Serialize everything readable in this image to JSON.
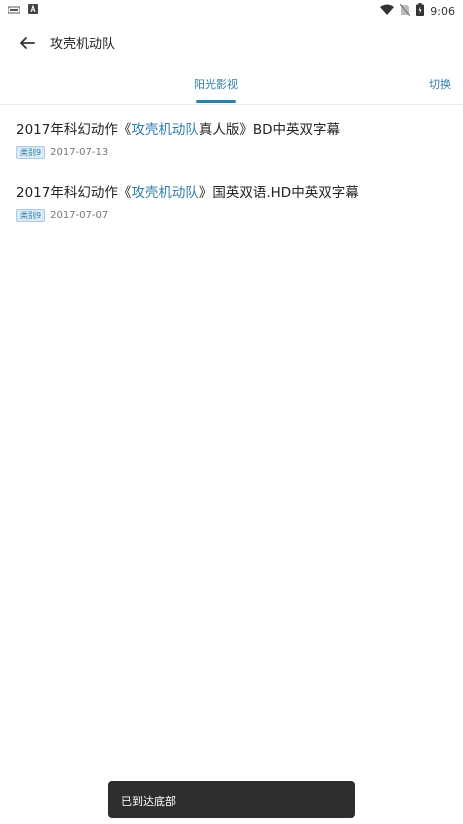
{
  "status_bar": {
    "time": "9:06",
    "icons": [
      "notification-icon",
      "font-app-icon",
      "wifi-icon",
      "no-sim-icon",
      "battery-charging-icon"
    ]
  },
  "app_bar": {
    "back_icon": "arrow-left-icon",
    "title": "攻壳机动队"
  },
  "tabs": {
    "active": "阳光影视",
    "switch_label": "切换"
  },
  "accent_color": "#2f7ea8",
  "results": [
    {
      "title_prefix": "2017年科幻动作《",
      "title_highlight": "攻壳机动队",
      "title_suffix": "真人版》BD中英双字幕",
      "badge": "类别9",
      "date": "2017-07-13"
    },
    {
      "title_prefix": "2017年科幻动作《",
      "title_highlight": "攻壳机动队",
      "title_suffix": "》国英双语.HD中英双字幕",
      "badge": "类别9",
      "date": "2017-07-07"
    }
  ],
  "toast": {
    "text": "已到达底部"
  }
}
